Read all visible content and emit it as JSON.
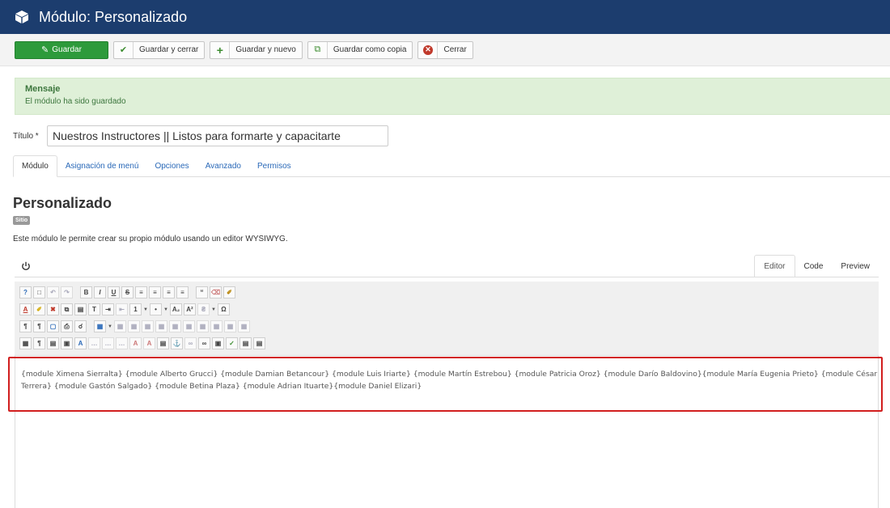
{
  "header": {
    "title": "Módulo: Personalizado",
    "icon": "cube-icon"
  },
  "toolbar": {
    "save_label": "Guardar",
    "save_close_label": "Guardar y cerrar",
    "save_new_label": "Guardar y nuevo",
    "save_copy_label": "Guardar como copia",
    "close_label": "Cerrar"
  },
  "message": {
    "title": "Mensaje",
    "text": "El módulo ha sido guardado"
  },
  "title_field": {
    "label": "Título",
    "required_mark": "*",
    "value": "Nuestros Instructores || Listos para formarte y capacitarte"
  },
  "tabs": [
    {
      "label": "Módulo",
      "active": true
    },
    {
      "label": "Asignación de menú",
      "active": false
    },
    {
      "label": "Opciones",
      "active": false
    },
    {
      "label": "Avanzado",
      "active": false
    },
    {
      "label": "Permisos",
      "active": false
    }
  ],
  "module": {
    "heading": "Personalizado",
    "badge": "Sitio",
    "description": "Este módulo le permite crear su propio módulo usando un editor WYSIWYG."
  },
  "editor": {
    "tabs": [
      "Editor",
      "Code",
      "Preview"
    ],
    "active_tab": "Editor",
    "content": "{module Ximena Sierralta} {module Alberto Grucci} {module Damian Betancour} {module Luis Iriarte} {module Martín Estrebou} {module Patricia Oroz} {module Darío Baldovino}{module María Eugenia Prieto} {module César Terrera} {module Gastón Salgado} {module Betina Plaza} {module Adrian Ituarte}{module Daniel Elizari}"
  },
  "colors": {
    "header_bg": "#1c3d6e",
    "save_green": "#2d9a3b",
    "message_bg": "#dff0d8",
    "highlight_red": "#d11e1e",
    "link_blue": "#2a69b8"
  }
}
